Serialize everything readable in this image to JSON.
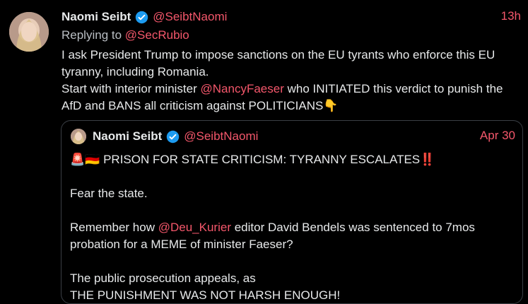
{
  "tweet": {
    "author_name": "Naomi Seibt",
    "author_handle": "@SeibtNaomi",
    "time": "13h",
    "reply_prefix": "Replying to",
    "reply_handle": "@SecRubio",
    "body_1": "I ask President Trump to impose sanctions on the EU tyrants who enforce this EU tyranny, including Romania.",
    "body_2_pre": "Start with interior minister",
    "body_2_mention": "@NancyFaeser",
    "body_2_post": "who INITIATED this verdict to punish the AfD and BANS all criticism against POLITICIANS",
    "emoji_point": "👇"
  },
  "quote": {
    "author_name": "Naomi Seibt",
    "author_handle": "@SeibtNaomi",
    "time": "Apr 30",
    "emoji_prefix": "🚨🇩🇪",
    "headline": "PRISON FOR STATE CRITICISM: TYRANNY ESCALATES",
    "emoji_suffix": "‼️",
    "p1": "Fear the state.",
    "p2_pre": "Remember how",
    "p2_mention": "@Deu_Kurier",
    "p2_post": "editor David Bendels was sentenced to 7mos probation for a MEME of minister Faeser?",
    "p3": "The public prosecution appeals, as",
    "p4": "THE PUNISHMENT WAS NOT HARSH ENOUGH!"
  },
  "colors": {
    "accent": "#f4576b",
    "text": "#e7e9ea",
    "muted": "#b9bec3",
    "verified": "#1d9bf0"
  }
}
